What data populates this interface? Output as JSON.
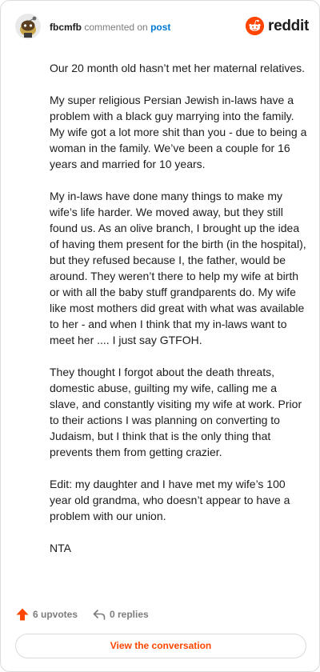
{
  "header": {
    "username": "fbcmfb",
    "action": "commented on",
    "post_link": "post",
    "brand_name": "reddit"
  },
  "comment": {
    "paragraphs": [
      "Our 20 month old hasn’t met her maternal relatives.",
      "My super religious Persian Jewish in-laws have a problem with a black guy marrying into the family. My wife got a lot more shit than you - due to being a woman in the family. We’ve been a couple for 16 years and married for 10 years.",
      "My in-laws have done many things to make my wife’s life harder. We moved away, but they still found us. As an olive branch, I brought up the idea of having them present for the birth (in the hospital), but they refused because I, the father, would be around. They weren’t there to help my wife at birth or with all the baby stuff grandparents do. My wife like most mothers did great with what was available to her - and when I think that my in-laws want to meet her .... I just say GTFOH.",
      "They thought I forgot about the death threats, domestic abuse, guilting my wife, calling me a slave, and constantly visiting my wife at work. Prior to their actions I was planning on converting to Judaism, but I think that is the only thing that prevents them from getting crazier.",
      "Edit: my daughter and I have met my wife’s 100 year old grandma, who doesn’t appear to have a problem with our union.",
      "NTA"
    ]
  },
  "footer": {
    "upvotes": "6 upvotes",
    "replies": "0 replies",
    "view_conversation": "View the conversation"
  },
  "colors": {
    "brand": "#ff4500",
    "link": "#0079d3",
    "muted": "#7c7c7c"
  },
  "icons": {
    "avatar": "snoo-avatar-icon",
    "brand": "reddit-logo-icon",
    "upvote": "upvote-arrow-icon",
    "reply": "reply-arrow-icon"
  }
}
